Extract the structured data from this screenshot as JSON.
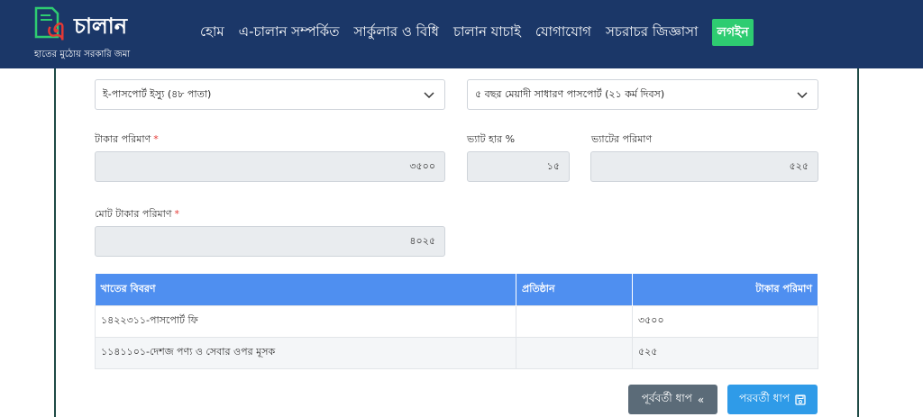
{
  "brand": {
    "name": "চালান",
    "logo_letter": "এ",
    "tagline": "হাতের মুঠোয় সরকারি জমা",
    "colors": {
      "navbar": "#1b3768",
      "logo_green": "#2ecc71",
      "logo_red": "#e53935"
    }
  },
  "nav": {
    "items": [
      "হোম",
      "এ-চালান সম্পর্কিত",
      "সার্কুলার ও বিধি",
      "চালান যাচাই",
      "যোগাযোগ",
      "সচরাচর জিজ্ঞাসা"
    ],
    "login": "লগইন"
  },
  "form": {
    "passport_type": "ই-পাসপোর্ট ইস্যু (৪৮ পাতা)",
    "delivery_type": "৫ বছর মেয়াদী সাধারণ পাসপোর্ট (২১ কর্ম দিবস)",
    "amount_label": "টাকার পরিমাণ",
    "amount_value": "৩৫০০",
    "vat_rate_label": "ভ্যাট হার %",
    "vat_rate_value": "১৫",
    "vat_amount_label": "ভ্যাটের পরিমাণ",
    "vat_amount_value": "৫২৫",
    "total_label": "মোট টাকার পরিমাণ",
    "total_value": "৪০২৫",
    "required_mark": "*"
  },
  "table": {
    "headers": [
      "খাতের বিবরণ",
      "প্রতিষ্ঠান",
      "টাকার পরিমাণ"
    ],
    "rows": [
      [
        "১৪২২৩১১-পাসপোর্ট ফি",
        "",
        "৩৫০০"
      ],
      [
        "১১৪১১০১-দেশজ পণ্য ও সেবার ওপর মূসক",
        "",
        "৫২৫"
      ]
    ],
    "header_color": "#4f8ff0"
  },
  "buttons": {
    "prev_label": "পূর্ববর্তী ধাপ",
    "prev_icon": "double-chevron-left-icon",
    "next_label": "পরবর্তী ধাপ",
    "next_icon": "save-icon"
  }
}
